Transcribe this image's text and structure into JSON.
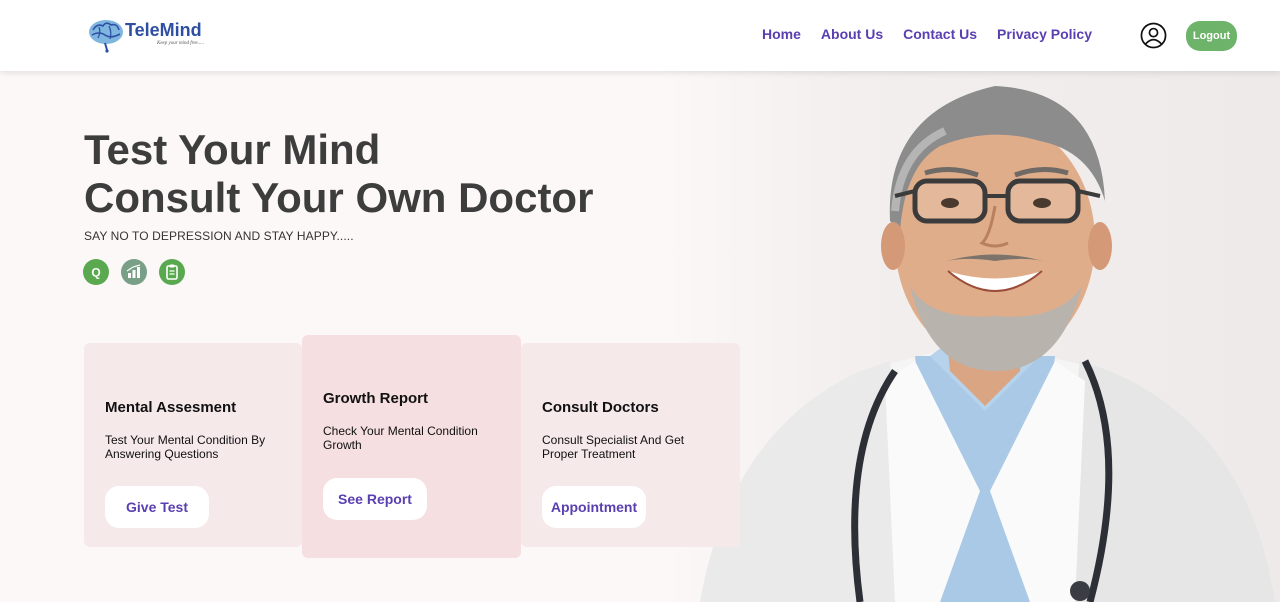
{
  "brand": {
    "name": "TeleMind",
    "tagline": "Keep your mind free....."
  },
  "nav": {
    "links": [
      "Home",
      "About Us",
      "Contact Us",
      "Privacy Policy"
    ],
    "logout_label": "Logout"
  },
  "hero": {
    "title_line1": "Test Your Mind",
    "title_line2": "Consult Your Own Doctor",
    "subtitle": "SAY NO TO DEPRESSION AND STAY HAPPY.....",
    "quick_icons": [
      "quiz-icon",
      "chart-icon",
      "clipboard-icon"
    ]
  },
  "cards": [
    {
      "title": "Mental Assesment",
      "description": "Test Your Mental Condition By Answering Questions",
      "button": "Give Test"
    },
    {
      "title": "Growth Report",
      "description": "Check Your Mental Condition Growth",
      "button": "See Report"
    },
    {
      "title": "Consult Doctors",
      "description": "Consult Specialist And Get Proper Treatment",
      "button": "Appointment"
    }
  ],
  "colors": {
    "nav_link": "#5a3fb0",
    "logout_bg": "#6db36a",
    "card_bg": "#f6e9ea",
    "card_active_bg": "#f5dfe0",
    "title": "#3d3d3d"
  }
}
